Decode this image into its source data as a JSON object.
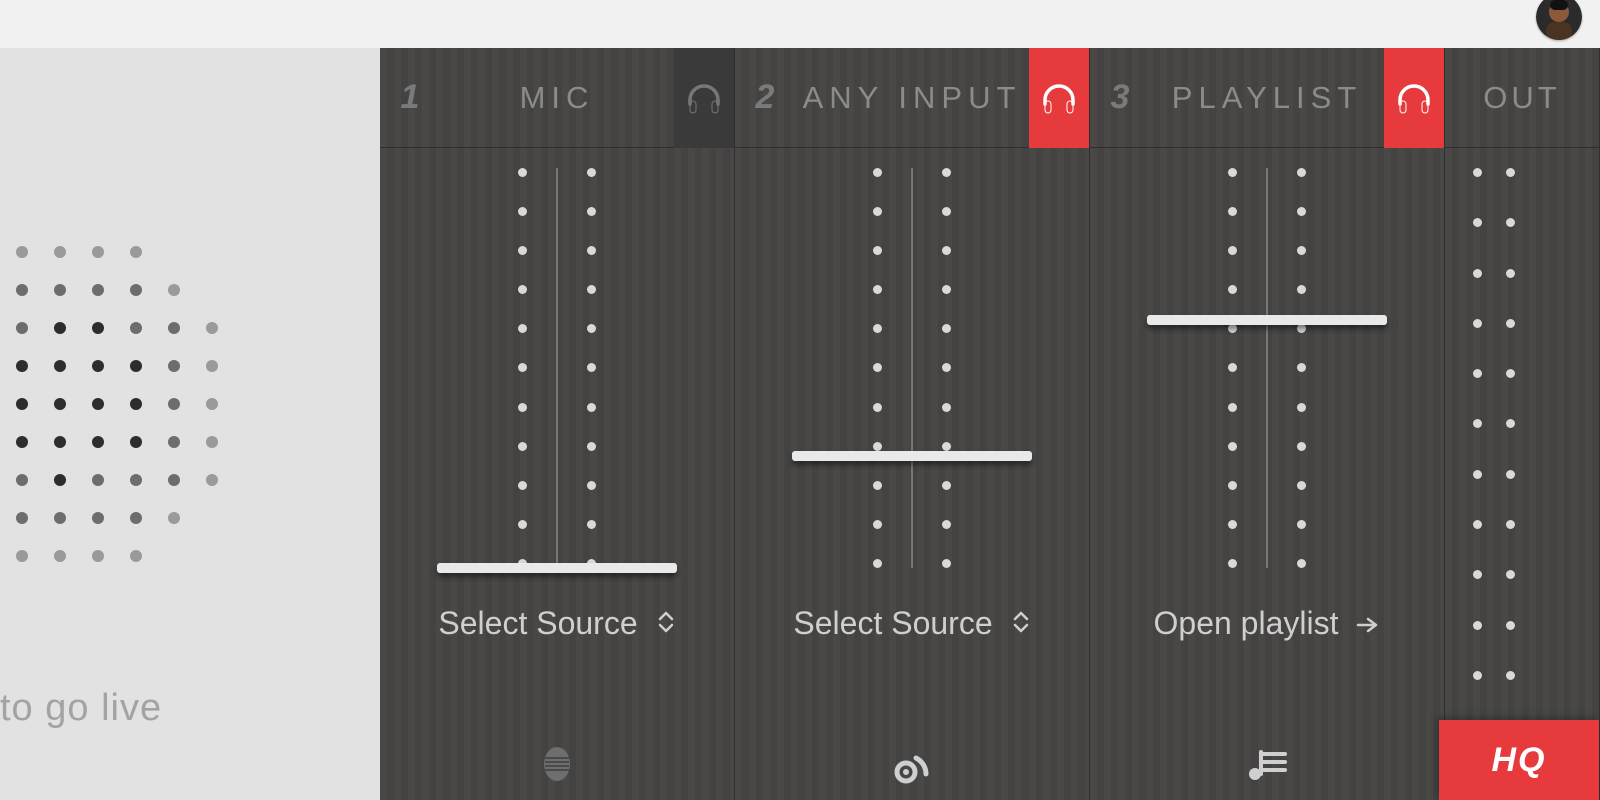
{
  "sidebar": {
    "go_live_text": "to go live"
  },
  "channels": [
    {
      "num": "1",
      "title": "MIC",
      "headphones_on": false,
      "fader_pct": 0,
      "source": "Select Source",
      "source_icon": "caret"
    },
    {
      "num": "2",
      "title": "ANY INPUT",
      "headphones_on": true,
      "fader_pct": 28,
      "source": "Select Source",
      "source_icon": "caret"
    },
    {
      "num": "3",
      "title": "PLAYLIST",
      "headphones_on": true,
      "fader_pct": 62,
      "source": "Open playlist",
      "source_icon": "arrow"
    }
  ],
  "out": {
    "title": "OUT",
    "hq_label": "HQ"
  },
  "colors": {
    "accent": "#e63a3d"
  }
}
